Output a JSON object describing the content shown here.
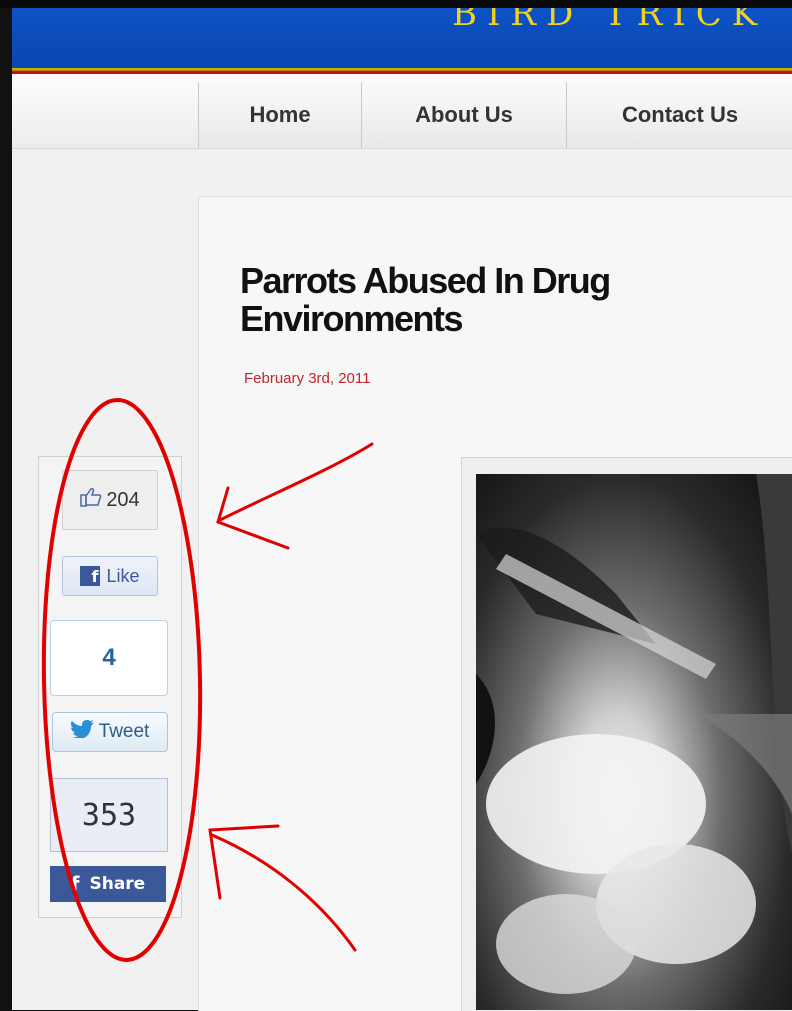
{
  "header": {
    "brand_fragment": "BIRD TRICK"
  },
  "nav": {
    "items": [
      {
        "label": "Home"
      },
      {
        "label": "About Us"
      },
      {
        "label": "Contact Us"
      }
    ]
  },
  "article": {
    "title": "Parrots Abused In Drug Environments",
    "date": "February 3rd, 2011"
  },
  "share_widgets": {
    "facebook_like_count": "204",
    "facebook_like_label": "Like",
    "tweet_count": "4",
    "tweet_label": "Tweet",
    "facebook_share_count": "353",
    "facebook_share_label": "Share"
  },
  "colors": {
    "header_blue": "#0d52c6",
    "brand_gold": "#f2d21c",
    "date_red": "#c0262c",
    "annotation_red": "#e00000",
    "facebook_blue": "#3b5998",
    "twitter_blue": "#25639b"
  },
  "icons": [
    "thumbs-up-icon",
    "facebook-f-icon",
    "twitter-bird-icon"
  ]
}
